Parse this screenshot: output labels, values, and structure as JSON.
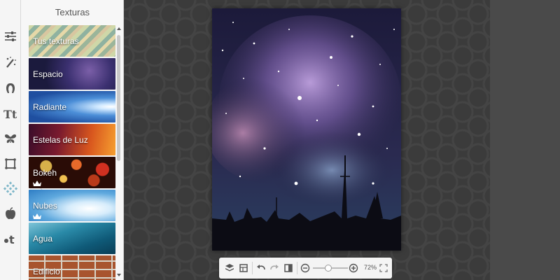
{
  "panel": {
    "title": "Texturas",
    "textures": [
      {
        "label": "Tus texturas",
        "premium": false
      },
      {
        "label": "Espacio",
        "premium": false
      },
      {
        "label": "Radiante",
        "premium": false
      },
      {
        "label": "Estelas de Luz",
        "premium": false
      },
      {
        "label": "Bokeh",
        "premium": true
      },
      {
        "label": "Nubes",
        "premium": true
      },
      {
        "label": "Agua",
        "premium": false
      },
      {
        "label": "Edificio",
        "premium": false
      }
    ]
  },
  "rail": {
    "tools": [
      "adjustments-icon",
      "magic-wand-icon",
      "touch-up-icon",
      "text-icon",
      "butterfly-icon",
      "frame-icon",
      "texture-icon",
      "apple-icon",
      "themes-icon"
    ],
    "active_tool": "texture-icon"
  },
  "toolbar": {
    "zoom": "72%"
  },
  "colors": {
    "workspace": "#3b3b3b",
    "panel": "#f7f7f7",
    "accent_active": "#7fb7c9"
  }
}
